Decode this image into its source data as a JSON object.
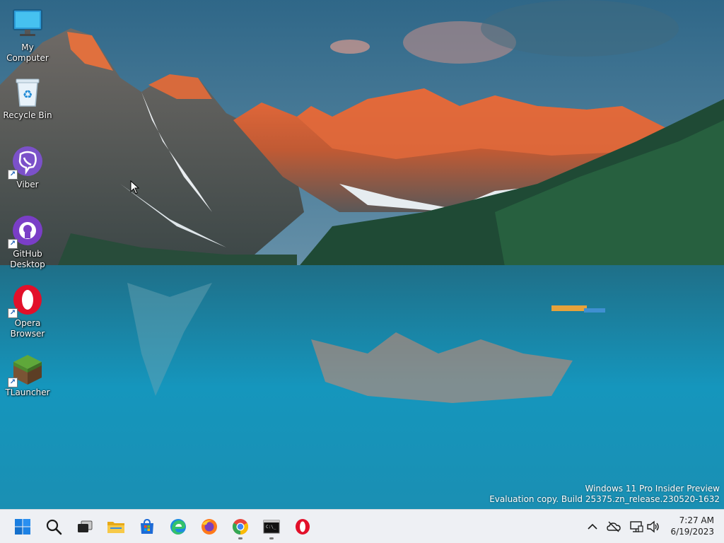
{
  "desktop": {
    "icons": [
      {
        "label": "My Computer",
        "icon": "monitor-icon"
      },
      {
        "label": "Recycle Bin",
        "icon": "recycle-bin-icon"
      },
      {
        "label": "Viber",
        "icon": "viber-icon",
        "shortcut": true
      },
      {
        "label": "GitHub\nDesktop",
        "icon": "github-icon",
        "shortcut": true
      },
      {
        "label": "Opera\nBrowser",
        "icon": "opera-icon",
        "shortcut": true
      },
      {
        "label": "TLauncher",
        "icon": "minecraft-block-icon",
        "shortcut": true
      }
    ],
    "watermark": {
      "line1": "Windows 11 Pro Insider Preview",
      "line2": "Evaluation copy. Build 25375.zn_release.230520-1632"
    }
  },
  "taskbar": {
    "apps": [
      {
        "name": "Start",
        "icon": "windows-start-icon"
      },
      {
        "name": "Search",
        "icon": "search-icon"
      },
      {
        "name": "Task View",
        "icon": "task-view-icon"
      },
      {
        "name": "File Explorer",
        "icon": "folder-icon"
      },
      {
        "name": "Microsoft Store",
        "icon": "store-icon"
      },
      {
        "name": "Microsoft Edge",
        "icon": "edge-icon"
      },
      {
        "name": "Firefox",
        "icon": "firefox-icon"
      },
      {
        "name": "Google Chrome",
        "icon": "chrome-icon",
        "running": true
      },
      {
        "name": "Terminal",
        "icon": "terminal-icon",
        "running": true
      },
      {
        "name": "Opera",
        "icon": "opera-icon"
      }
    ],
    "tray": {
      "icons": [
        "chevron-up-icon",
        "onedrive-offline-icon",
        "network-icon",
        "volume-icon"
      ],
      "time": "7:27 AM",
      "date": "6/19/2023"
    }
  },
  "colors": {
    "taskbar_bg": "#eef0f4",
    "accent": "#0067c0"
  }
}
